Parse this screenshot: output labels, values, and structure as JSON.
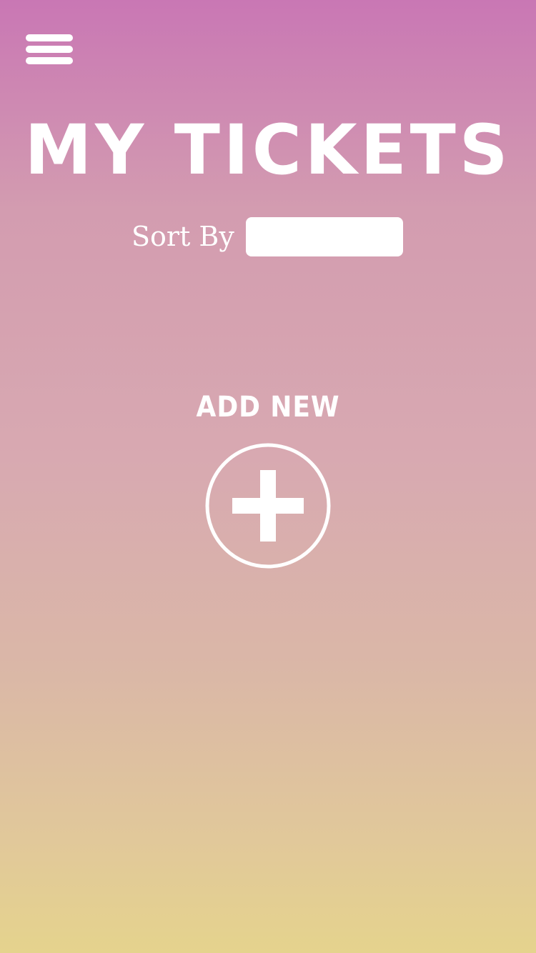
{
  "header": {
    "menu_icon": "hamburger-menu-icon",
    "title": "MY TICKETS"
  },
  "sort": {
    "label": "Sort By",
    "selected_value": ""
  },
  "add_new": {
    "label": "ADD NEW",
    "icon": "plus-circle-icon"
  },
  "colors": {
    "gradient_top": "#c977b4",
    "gradient_bottom": "#e5d38d",
    "foreground": "#ffffff"
  }
}
